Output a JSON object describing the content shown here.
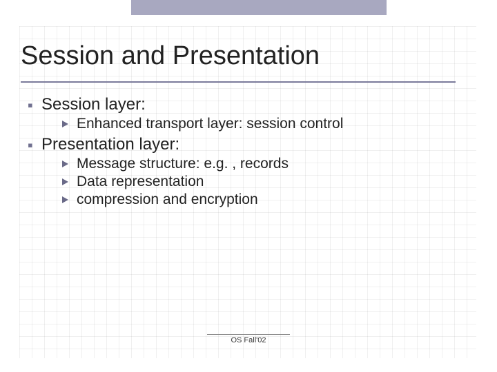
{
  "title": "Session and Presentation",
  "bullets": [
    {
      "label": "Session layer:",
      "children": [
        "Enhanced transport layer: session control"
      ]
    },
    {
      "label": "Presentation layer:",
      "children": [
        "Message structure: e.g. , records",
        "Data representation",
        "compression and encryption"
      ]
    }
  ],
  "footer": "OS Fall'02"
}
